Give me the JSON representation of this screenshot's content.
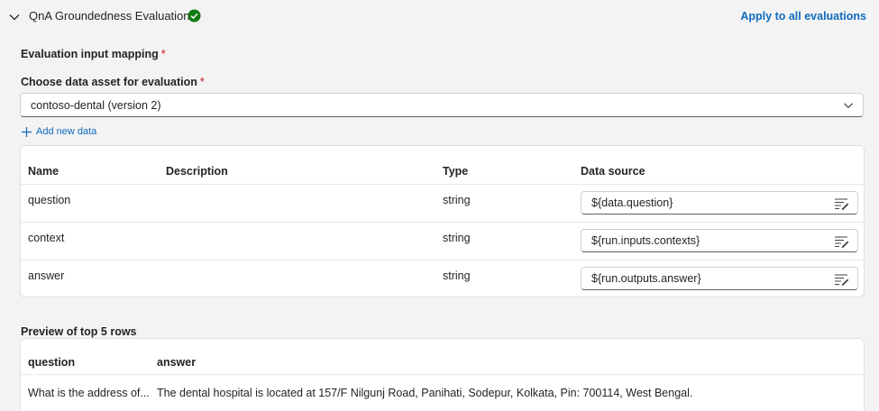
{
  "section": {
    "title": "QnA Groundedness Evaluation",
    "apply_link": "Apply to all evaluations"
  },
  "mapping": {
    "heading": "Evaluation input mapping",
    "required_mark": "*"
  },
  "data_asset": {
    "label": "Choose data asset for evaluation",
    "required_mark": "*",
    "selected": "contoso-dental (version 2)",
    "add_new_label": "Add new data"
  },
  "mapping_table": {
    "columns": [
      "Name",
      "Description",
      "Type",
      "Data source"
    ],
    "rows": [
      {
        "name": "question",
        "description": "",
        "type": "string",
        "source": "${data.question}"
      },
      {
        "name": "context",
        "description": "",
        "type": "string",
        "source": "${run.inputs.contexts}"
      },
      {
        "name": "answer",
        "description": "",
        "type": "string",
        "source": "${run.outputs.answer}"
      }
    ]
  },
  "preview": {
    "heading": "Preview of top 5 rows",
    "columns": [
      "question",
      "answer"
    ],
    "rows": [
      {
        "question": "What is the address of...",
        "answer": "The dental hospital is located at 157/F Nilgunj Road, Panihati, Sodepur, Kolkata, Pin: 700114, West Bengal."
      }
    ]
  },
  "colors": {
    "accent": "#0f6cbd",
    "success": "#107c10",
    "required": "#c50f1f",
    "background": "#f3f3f3"
  },
  "icons": {
    "collapse": "chevron-down-icon",
    "status": "checkmark-circle-icon",
    "dropdown": "chevron-down-icon",
    "add": "plus-icon",
    "source_picker": "text-edit-icon"
  }
}
